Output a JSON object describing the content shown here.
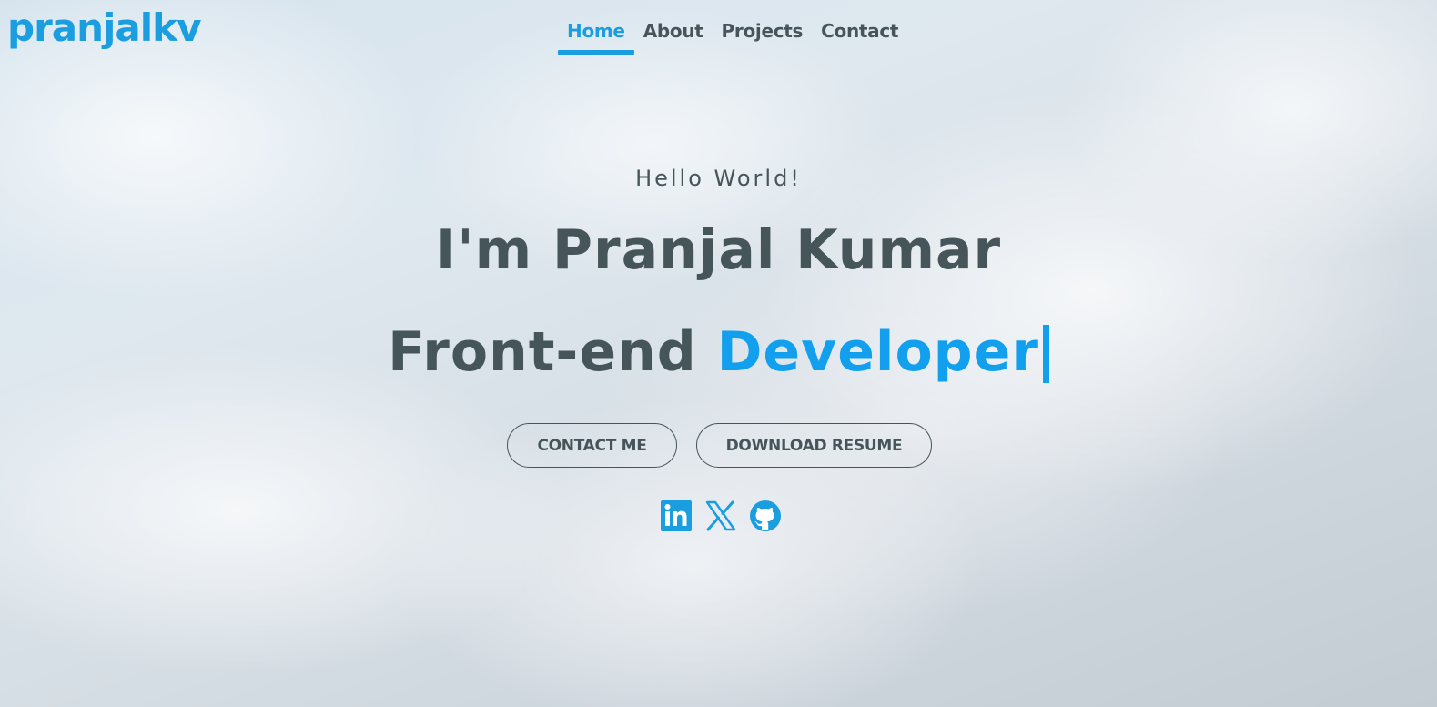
{
  "brand": {
    "logo_text": "pranjalkv",
    "accent_color": "#1a9ee0",
    "text_color": "#45555a"
  },
  "nav": {
    "items": [
      {
        "label": "Home",
        "active": true
      },
      {
        "label": "About",
        "active": false
      },
      {
        "label": "Projects",
        "active": false
      },
      {
        "label": "Contact",
        "active": false
      }
    ]
  },
  "hero": {
    "greeting": "Hello World!",
    "name_line": "I'm Pranjal Kumar",
    "role_prefix": "Front-end",
    "role_highlight": "Developer",
    "typing_cursor": "|"
  },
  "buttons": {
    "contact_label": "CONTACT ME",
    "resume_label": "DOWNLOAD RESUME"
  },
  "socials": [
    {
      "name": "LinkedIn",
      "icon": "linkedin-icon"
    },
    {
      "name": "X",
      "icon": "x-twitter-icon"
    },
    {
      "name": "GitHub",
      "icon": "github-icon"
    }
  ]
}
